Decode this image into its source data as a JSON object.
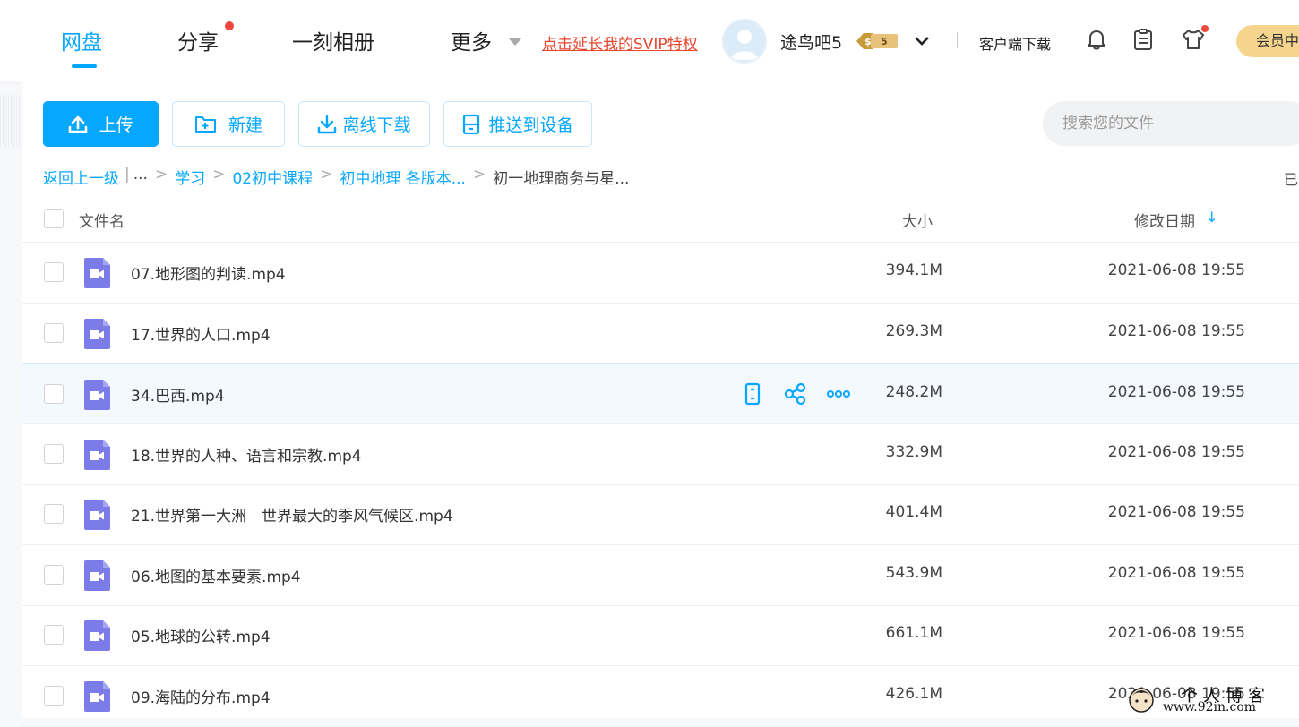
{
  "nav": {
    "tabs": [
      {
        "label": "网盘",
        "active": true
      },
      {
        "label": "分享",
        "has_dot": true
      },
      {
        "label": "一刻相册"
      },
      {
        "label": "更多"
      }
    ],
    "svip_link": "点击延长我的SVIP特权",
    "username": "途鸟吧5",
    "badge_level": "5",
    "client_download": "客户端下载",
    "vip_button": "会员中心",
    "icons": [
      "bell-icon",
      "clipboard-icon",
      "shirt-icon"
    ]
  },
  "toolbar": {
    "upload": "上传",
    "new": "新建",
    "offline_download": "离线下载",
    "push_to_device": "推送到设备",
    "search_placeholder": "搜索您的文件"
  },
  "breadcrumb": {
    "back": "返回上一级",
    "ellipsis": "...",
    "items": [
      "学习",
      "02初中课程",
      "初中地理 各版本...",
      "初一地理商务与星..."
    ],
    "edge_char": "已"
  },
  "table": {
    "col_name": "文件名",
    "col_size": "大小",
    "col_date": "修改日期",
    "sort_indicator": "↓",
    "rows": [
      {
        "name": "07.地形图的判读.mp4",
        "size": "394.1M",
        "date": "2021-06-08 19:55"
      },
      {
        "name": "17.世界的人口.mp4",
        "size": "269.3M",
        "date": "2021-06-08 19:55"
      },
      {
        "name": "34.巴西.mp4",
        "size": "248.2M",
        "date": "2021-06-08 19:55",
        "hover": true
      },
      {
        "name": "18.世界的人种、语言和宗教.mp4",
        "size": "332.9M",
        "date": "2021-06-08 19:55"
      },
      {
        "name": "21.世界第一大洲　世界最大的季风气候区.mp4",
        "size": "401.4M",
        "date": "2021-06-08 19:55"
      },
      {
        "name": "06.地图的基本要素.mp4",
        "size": "543.9M",
        "date": "2021-06-08 19:55"
      },
      {
        "name": "05.地球的公转.mp4",
        "size": "661.1M",
        "date": "2021-06-08 19:55"
      },
      {
        "name": "09.海陆的分布.mp4",
        "size": "426.1M",
        "date": "2021-06-08 19:55"
      }
    ]
  },
  "watermark": {
    "title": "个人博客",
    "url": "www.92in.com"
  },
  "colors": {
    "accent": "#06a7ff",
    "svip_link": "#e8462d",
    "video_icon": "#7c7ce8",
    "vip_button": "#f5d58e"
  }
}
